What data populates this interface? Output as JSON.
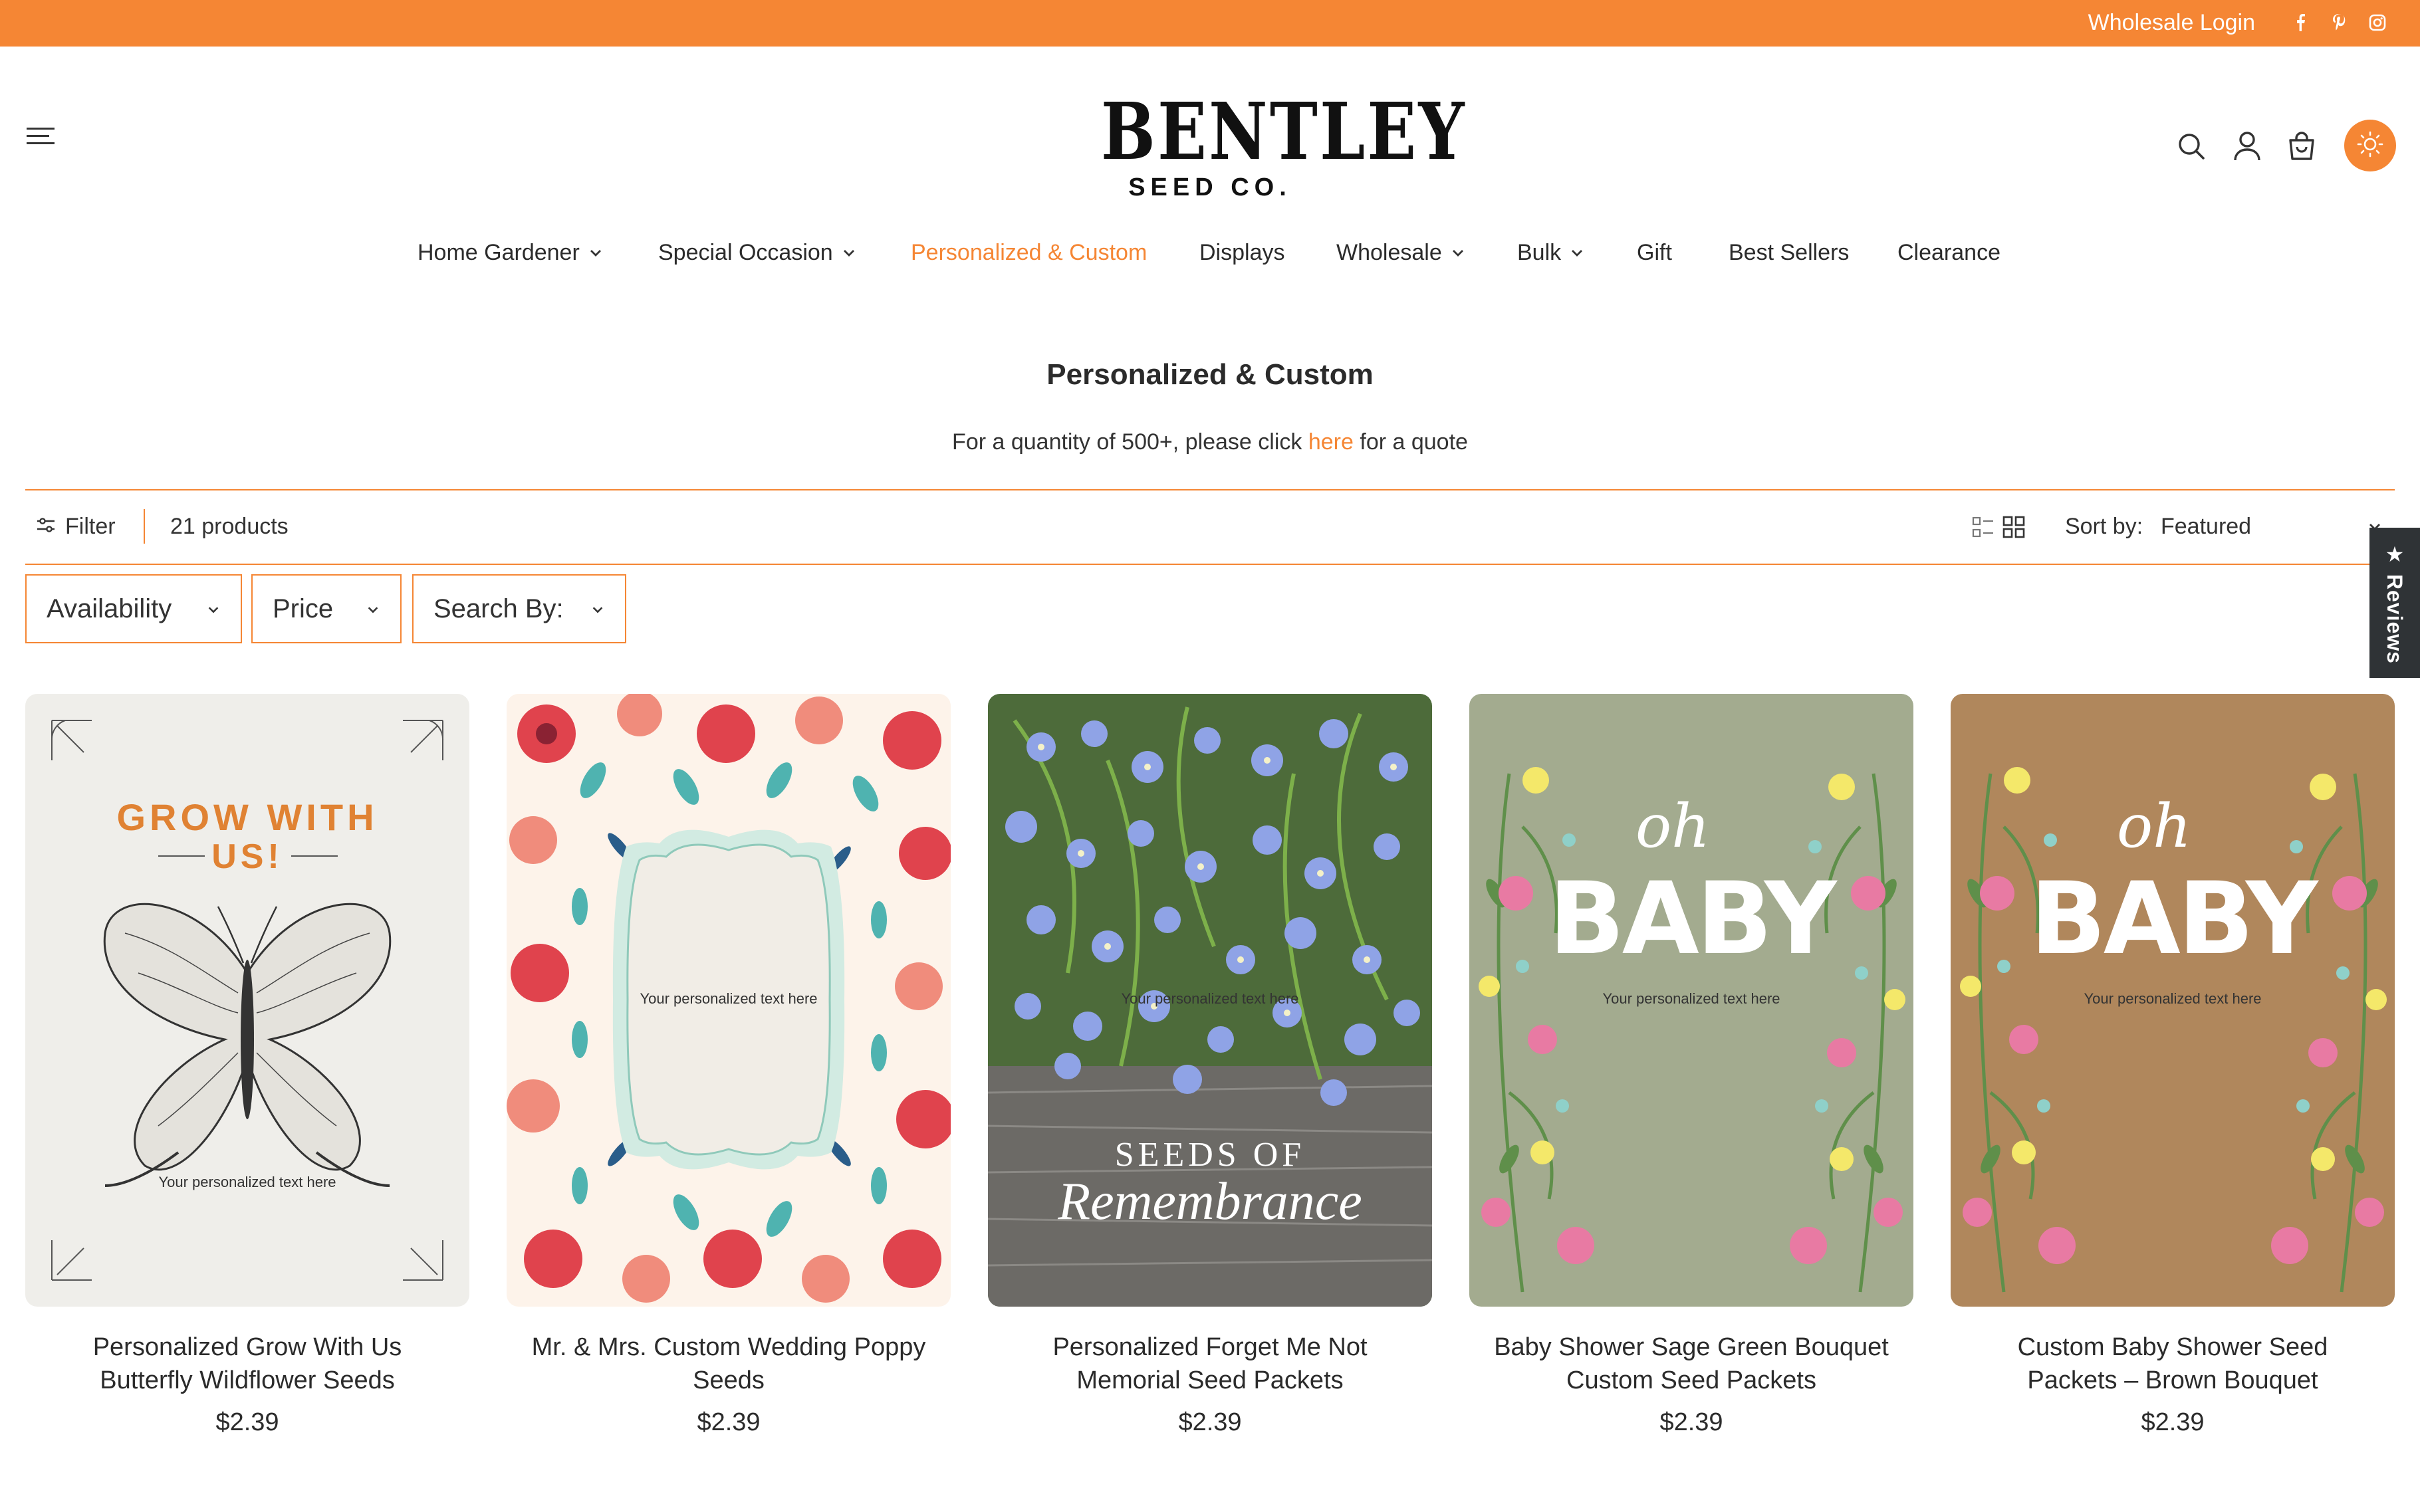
{
  "topbar": {
    "wholesale_login": "Wholesale Login",
    "social": [
      "facebook-icon",
      "pinterest-icon",
      "instagram-icon"
    ],
    "color": "#f58634"
  },
  "header": {
    "logo_main": "BENTLEY",
    "logo_sub": "SEED CO.",
    "icons": [
      "menu-icon",
      "search-icon",
      "account-icon",
      "cart-icon",
      "sun-icon"
    ]
  },
  "nav": [
    {
      "label": "Home Gardener",
      "has_dropdown": true
    },
    {
      "label": "Special Occasion",
      "has_dropdown": true
    },
    {
      "label": "Personalized & Custom",
      "has_dropdown": false,
      "active": true
    },
    {
      "label": "Displays",
      "has_dropdown": false
    },
    {
      "label": "Wholesale",
      "has_dropdown": true
    },
    {
      "label": "Bulk",
      "has_dropdown": true
    },
    {
      "label": "Gift",
      "has_dropdown": false
    },
    {
      "label": "Best Sellers",
      "has_dropdown": false
    },
    {
      "label": "Clearance",
      "has_dropdown": false
    }
  ],
  "collection": {
    "title": "Personalized & Custom",
    "desc_before": "For a quantity of 500+, please click ",
    "desc_link": "here",
    "desc_after": " for a quote"
  },
  "toolbar": {
    "filter_label": "Filter",
    "product_count": "21 products",
    "sort_label": "Sort by:",
    "sort_value": "Featured"
  },
  "filters": [
    "Availability",
    "Price",
    "Search By:"
  ],
  "reviews_tab": "★ Reviews",
  "products": [
    {
      "title_line1": "Personalized Grow With Us",
      "title_line2": "Butterfly Wildflower Seeds",
      "price": "$2.39",
      "art_heading_1": "GROW WITH",
      "art_heading_2": "US!",
      "art_text": "Your personalized text here"
    },
    {
      "title_line1": "Mr. & Mrs. Custom Wedding Poppy",
      "title_line2": "Seeds",
      "price": "$2.39",
      "art_text": "Your personalized text here"
    },
    {
      "title_line1": "Personalized Forget Me Not",
      "title_line2": "Memorial Seed Packets",
      "price": "$2.39",
      "art_heading_1": "SEEDS OF",
      "art_heading_2": "Remembrance",
      "art_text": "Your personalized text here"
    },
    {
      "title_line1": "Baby Shower Sage Green Bouquet",
      "title_line2": "Custom Seed Packets",
      "price": "$2.39",
      "art_heading_1": "oh",
      "art_heading_2": "BABY",
      "art_text": "Your personalized text here"
    },
    {
      "title_line1": "Custom Baby Shower Seed",
      "title_line2": "Packets – Brown Bouquet",
      "price": "$2.39",
      "art_heading_1": "oh",
      "art_heading_2": "BABY",
      "art_text": "Your personalized text here"
    }
  ]
}
